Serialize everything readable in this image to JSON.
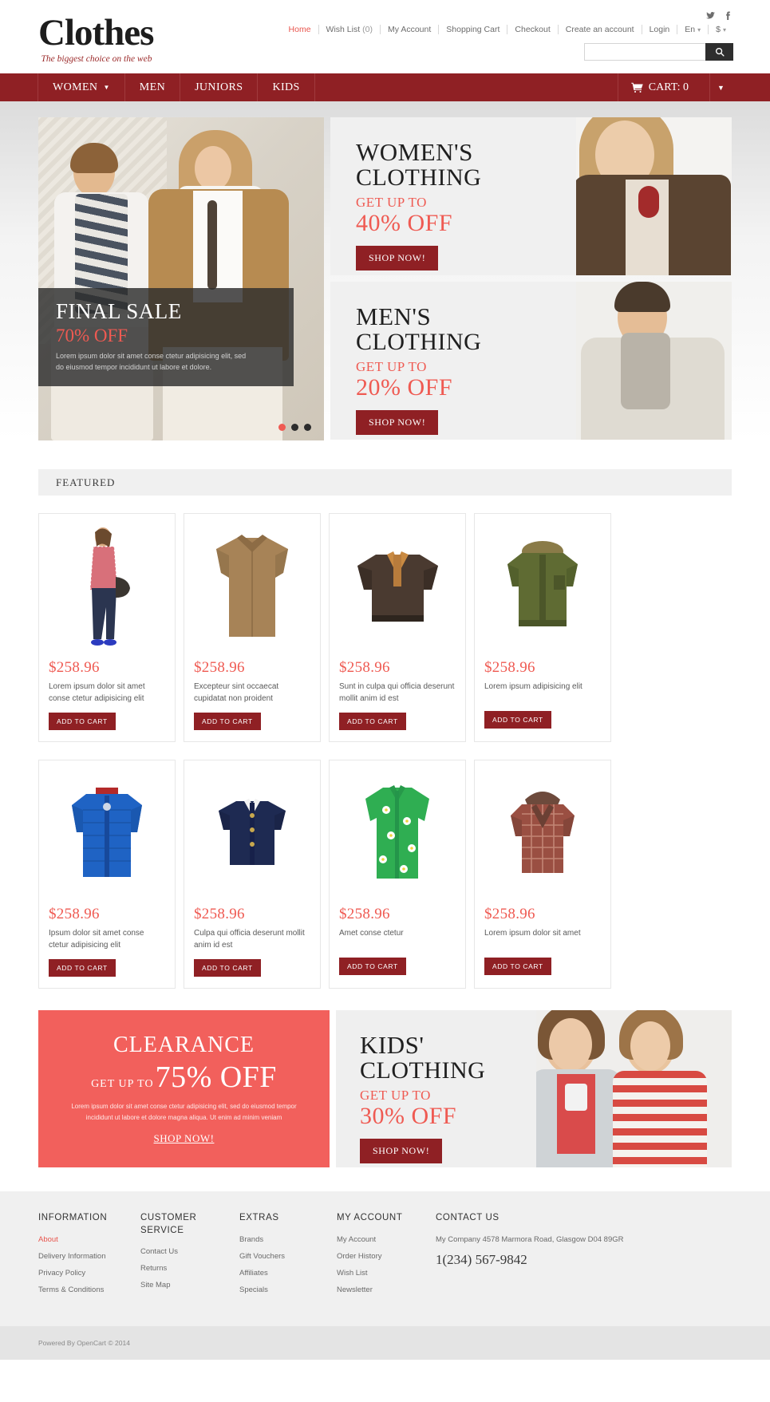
{
  "header": {
    "logo_title": "Clothes",
    "logo_tagline": "The biggest choice on the web",
    "social": [
      {
        "name": "twitter-icon",
        "label": "Twitter"
      },
      {
        "name": "facebook-icon",
        "label": "Facebook"
      }
    ],
    "top_links": [
      {
        "label": "Home",
        "active": true
      },
      {
        "label": "Wish List",
        "count": "(0)"
      },
      {
        "label": "My Account"
      },
      {
        "label": "Shopping Cart"
      },
      {
        "label": "Checkout"
      },
      {
        "label": "Create an account"
      },
      {
        "label": "Login"
      },
      {
        "label": "En",
        "caret": true
      },
      {
        "label": "$",
        "caret": true
      }
    ],
    "search": {
      "value": "",
      "placeholder": ""
    }
  },
  "nav": {
    "items": [
      {
        "label": "WOMEN",
        "has_dropdown": true
      },
      {
        "label": "MEN",
        "has_dropdown": false
      },
      {
        "label": "JUNIORS",
        "has_dropdown": false
      },
      {
        "label": "KIDS",
        "has_dropdown": false
      }
    ],
    "cart_label": "CART: 0"
  },
  "slider": {
    "caption_title": "FINAL SALE",
    "caption_sub": "70% OFF",
    "caption_text": "Lorem ipsum dolor sit amet conse ctetur adipisicing elit, sed do eiusmod tempor incididunt ut labore et dolore.",
    "dots": 3,
    "active_dot": 0
  },
  "promos": [
    {
      "title_line1": "WOMEN'S",
      "title_line2": "CLOTHING",
      "get_up_to": "GET UP TO",
      "discount": "40% OFF",
      "button": "SHOP NOW!"
    },
    {
      "title_line1": "MEN'S",
      "title_line2": "CLOTHING",
      "get_up_to": "GET UP TO",
      "discount": "20% OFF",
      "button": "SHOP NOW!"
    }
  ],
  "featured": {
    "heading": "FEATURED",
    "add_to_cart_label": "ADD TO CART",
    "products": [
      {
        "price": "$258.96",
        "desc": "Lorem ipsum dolor sit amet conse ctetur adipisicing elit",
        "img": "woman-top-jeans"
      },
      {
        "price": "$258.96",
        "desc": "Excepteur sint occaecat cupidatat non proident",
        "img": "tan-suede-shirt"
      },
      {
        "price": "$258.96",
        "desc": "Sunt in culpa qui officia deserunt mollit anim id est",
        "img": "brown-leather-jacket"
      },
      {
        "price": "$258.96",
        "desc": "Lorem ipsum  adipisicing elit",
        "img": "green-parka"
      },
      {
        "price": "$258.96",
        "desc": "Ipsum dolor sit amet conse ctetur adipisicing elit",
        "img": "blue-puffer-jacket"
      },
      {
        "price": "$258.96",
        "desc": "Culpa qui officia deserunt mollit anim id est",
        "img": "navy-cardigan"
      },
      {
        "price": "$258.96",
        "desc": "Amet conse ctetur",
        "img": "green-floral-blouse"
      },
      {
        "price": "$258.96",
        "desc": "Lorem ipsum dolor sit amet",
        "img": "plaid-hooded-jacket"
      }
    ]
  },
  "clearance": {
    "title": "CLEARANCE",
    "get_up_to": "GET UP TO",
    "discount": "75% OFF",
    "text": "Lorem ipsum dolor sit amet conse ctetur adipisicing elit, sed do eiusmod tempor incididunt ut labore et dolore magna aliqua. Ut enim ad minim veniam",
    "link": "SHOP NOW!"
  },
  "kids_promo": {
    "title_line1": "KIDS'",
    "title_line2": "CLOTHING",
    "get_up_to": "GET UP TO",
    "discount": "30% OFF",
    "button": "SHOP NOW!"
  },
  "footer": {
    "columns": [
      {
        "heading": "INFORMATION",
        "links": [
          {
            "label": "About",
            "active": true
          },
          {
            "label": "Delivery Information"
          },
          {
            "label": "Privacy Policy"
          },
          {
            "label": "Terms & Conditions"
          }
        ]
      },
      {
        "heading": "CUSTOMER SERVICE",
        "links": [
          {
            "label": "Contact Us"
          },
          {
            "label": "Returns"
          },
          {
            "label": "Site Map"
          }
        ]
      },
      {
        "heading": "EXTRAS",
        "links": [
          {
            "label": "Brands"
          },
          {
            "label": "Gift Vouchers"
          },
          {
            "label": "Affiliates"
          },
          {
            "label": "Specials"
          }
        ]
      },
      {
        "heading": "MY ACCOUNT",
        "links": [
          {
            "label": "My Account"
          },
          {
            "label": "Order History"
          },
          {
            "label": "Wish List"
          },
          {
            "label": "Newsletter"
          }
        ]
      }
    ],
    "contact": {
      "heading": "CONTACT US",
      "address": "My Company  4578 Marmora Road, Glasgow D04 89GR",
      "phone": "1(234) 567-9842"
    },
    "copyright": "Powered By OpenCart © 2014"
  },
  "colors": {
    "brand_red": "#8f2024",
    "accent_coral": "#ef5a52",
    "clearance_bg": "#f2605c"
  }
}
